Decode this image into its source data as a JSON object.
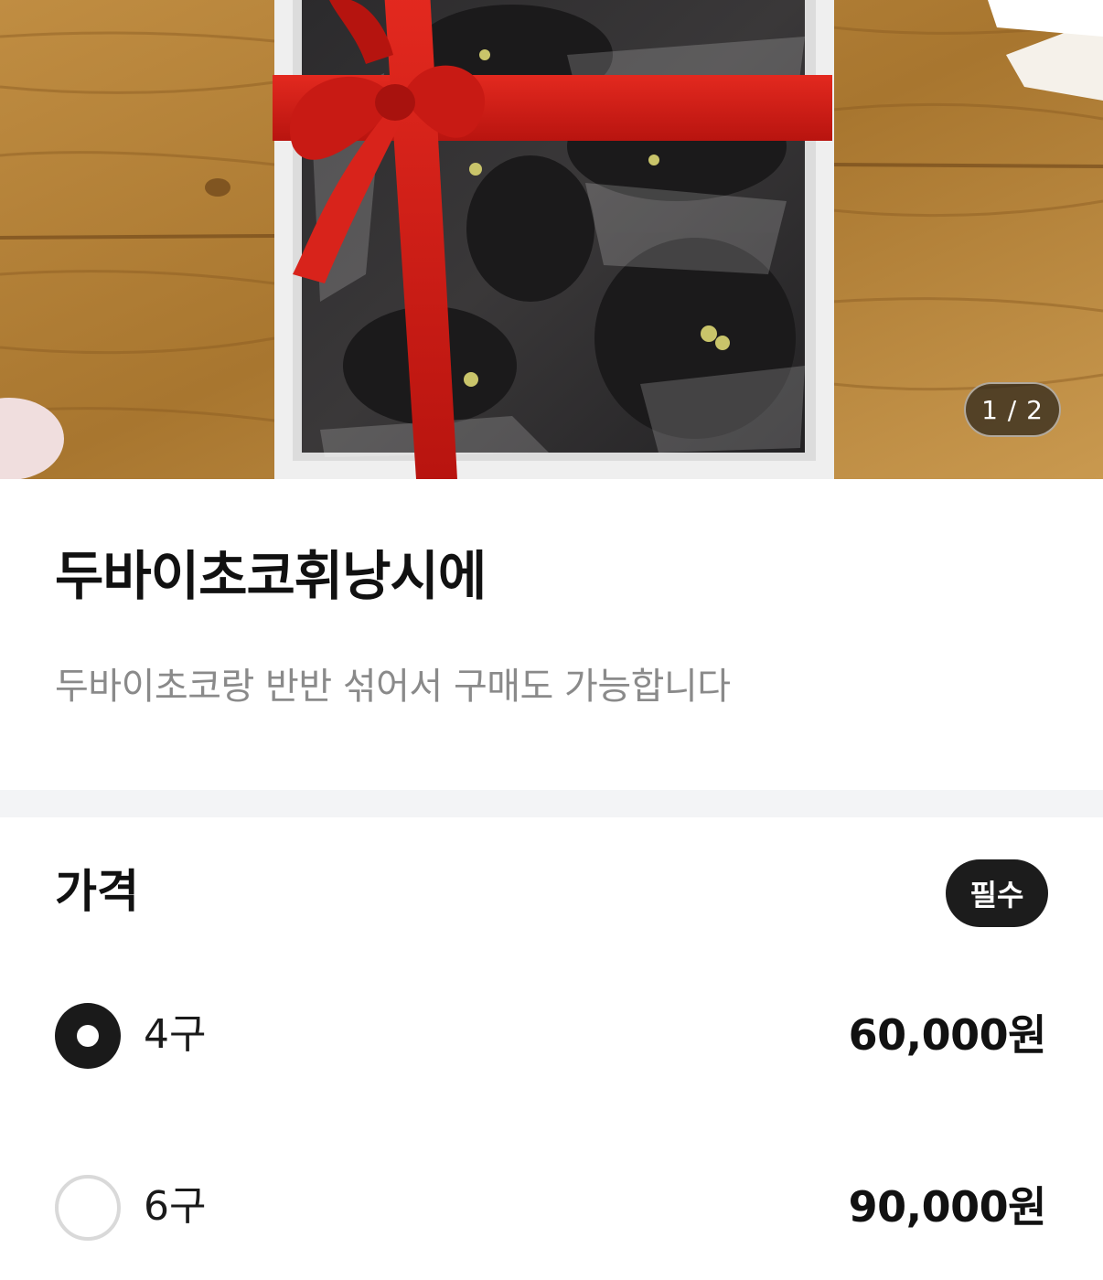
{
  "hero": {
    "page_indicator": "1 / 2"
  },
  "product": {
    "title": "두바이초코휘낭시에",
    "description": "두바이초코랑 반반 섞어서 구매도 가능합니다"
  },
  "price_section": {
    "title": "가격",
    "badge": "필수",
    "options": [
      {
        "label": "4구",
        "price": "60,000원",
        "selected": true
      },
      {
        "label": "6구",
        "price": "90,000원",
        "selected": false
      }
    ]
  },
  "colors": {
    "ribbon": "#d81f1f",
    "wood": "#b27d36",
    "badge_bg": "#1c1c1c",
    "description_text": "#8a8a8a",
    "divider": "#f3f4f6"
  }
}
